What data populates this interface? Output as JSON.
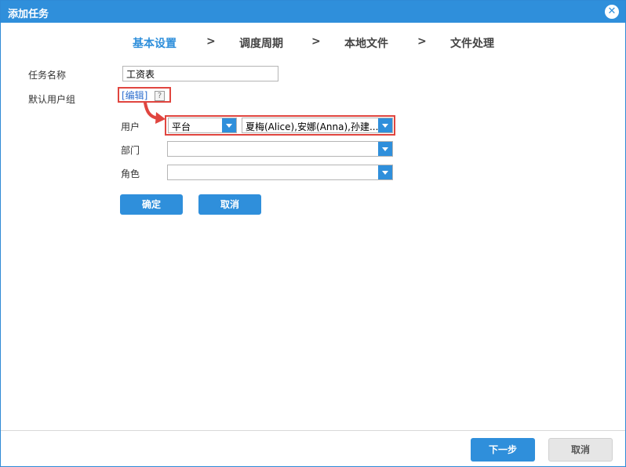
{
  "dialog": {
    "title": "添加任务"
  },
  "steps": [
    {
      "label": "基本设置",
      "active": true
    },
    {
      "label": "调度周期",
      "active": false
    },
    {
      "label": "本地文件",
      "active": false
    },
    {
      "label": "文件处理",
      "active": false
    }
  ],
  "step_separator": ">",
  "form": {
    "task_name_label": "任务名称",
    "task_name_value": "工资表",
    "default_group_label": "默认用户组",
    "edit_link": "[编辑]",
    "help": "?",
    "user_label": "用户",
    "user_source_value": "平台",
    "user_value": "夏梅(Alice),安娜(Anna),孙建...",
    "department_label": "部门",
    "department_value": "",
    "role_label": "角色",
    "role_value": "",
    "confirm_button": "确定",
    "cancel_button": "取消"
  },
  "footer": {
    "next_button": "下一步",
    "cancel_button": "取消"
  },
  "colors": {
    "accent": "#2f8fdb",
    "highlight": "#e0453f"
  }
}
